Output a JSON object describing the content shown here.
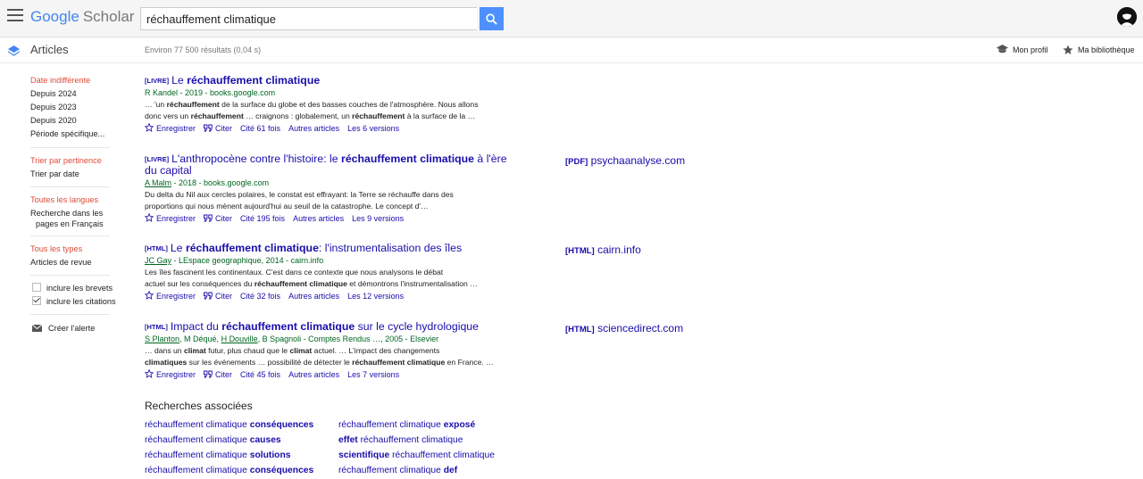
{
  "header": {
    "logo_google": "Google",
    "logo_scholar": "Scholar",
    "search_value": "réchauffement climatique"
  },
  "subheader": {
    "section": "Articles",
    "results_count": "Environ 77 500 résultats (0,04 s)",
    "profile": "Mon profil",
    "library": "Ma bibliothèque"
  },
  "sidebar": {
    "date": [
      "Date indifférente",
      "Depuis 2024",
      "Depuis 2023",
      "Depuis 2020",
      "Période spécifique..."
    ],
    "sort": [
      "Trier par pertinence",
      "Trier par date"
    ],
    "lang": [
      "Toutes les langues",
      "Recherche dans les",
      "pages en Français"
    ],
    "type": [
      "Tous les types",
      "Articles de revue"
    ],
    "checkboxes": [
      "inclure les brevets",
      "inclure les citations"
    ],
    "alert": "Créer l'alerte"
  },
  "actions": {
    "save": "Enregistrer",
    "cite": "Citer",
    "related": "Autres articles"
  },
  "results": [
    {
      "type": "[LIVRE]",
      "title_parts": [
        "Le ",
        "réchauffement climatique",
        ""
      ],
      "authors": "R Kandel - 2019 - books.google.com",
      "snippet1": "… 'un <b>réchauffement</b> de la surface du globe et des basses couches de l'atmosphère. Nous allons",
      "snippet2": "donc vers un <b>réchauffement</b> … craignons : globalement, un <b>réchauffement</b> à la surface de la …",
      "cited": "Cité 61 fois",
      "versions": "Les 6 versions"
    },
    {
      "type": "[LIVRE]",
      "title_parts": [
        "L'anthropocène contre l'histoire: le ",
        "réchauffement climatique",
        " à l'ère du capital"
      ],
      "authors": "<u>A Malm</u> - 2018 - books.google.com",
      "snippet1": "Du delta du Nil aux cercles polaires, le constat est effrayant: la Terre se réchauffe dans des",
      "snippet2": "proportions qui nous mènent aujourd'hui au seuil de la catastrophe. Le concept d'…",
      "cited": "Cité 195 fois",
      "versions": "Les 9 versions",
      "side_type": "[PDF]",
      "side_domain": "psychaanalyse.com"
    },
    {
      "type": "[HTML]",
      "title_parts": [
        "Le ",
        "réchauffement climatique",
        ": l'instrumentalisation des îles"
      ],
      "authors": "<u>JC Gay</u> - LEspace geographique, 2014 - cairn.info",
      "snippet1": "Les îles fascinent les continentaux. C'est dans ce contexte que nous analysons le débat",
      "snippet2": "actuel sur les conséquences du <b>réchauffement climatique</b> et démontrons l'instrumentalisation …",
      "cited": "Cité 32 fois",
      "versions": "Les 12 versions",
      "side_type": "[HTML]",
      "side_domain": "cairn.info"
    },
    {
      "type": "[HTML]",
      "title_parts": [
        "Impact du ",
        "réchauffement climatique",
        " sur le cycle hydrologique"
      ],
      "authors": "<u>S Planton</u>, M Déqué, <u>H Douville</u>, B Spagnoli - Comptes Rendus …, 2005 - Elsevier",
      "snippet1": "… dans un <b>climat</b> futur, plus chaud que le <b>climat</b> actuel. … L'impact des changements",
      "snippet2": "<b>climatiques</b> sur les événements … possibilité de détecter le <b>réchauffement climatique</b> en France. …",
      "cited": "Cité 45 fois",
      "versions": "Les 7 versions",
      "side_type": "[HTML]",
      "side_domain": "sciencedirect.com"
    }
  ],
  "related": {
    "title": "Recherches associées",
    "left": [
      "réchauffement climatique <b>conséquences</b>",
      "réchauffement climatique <b>causes</b>",
      "réchauffement climatique <b>solutions</b>",
      "réchauffement climatique <b>conséquences</b>"
    ],
    "right": [
      "réchauffement climatique <b>exposé</b>",
      "<b>effet</b> réchauffement climatique",
      "<b>scientifique</b> réchauffement climatique",
      "réchauffement climatique <b>def</b>"
    ]
  }
}
